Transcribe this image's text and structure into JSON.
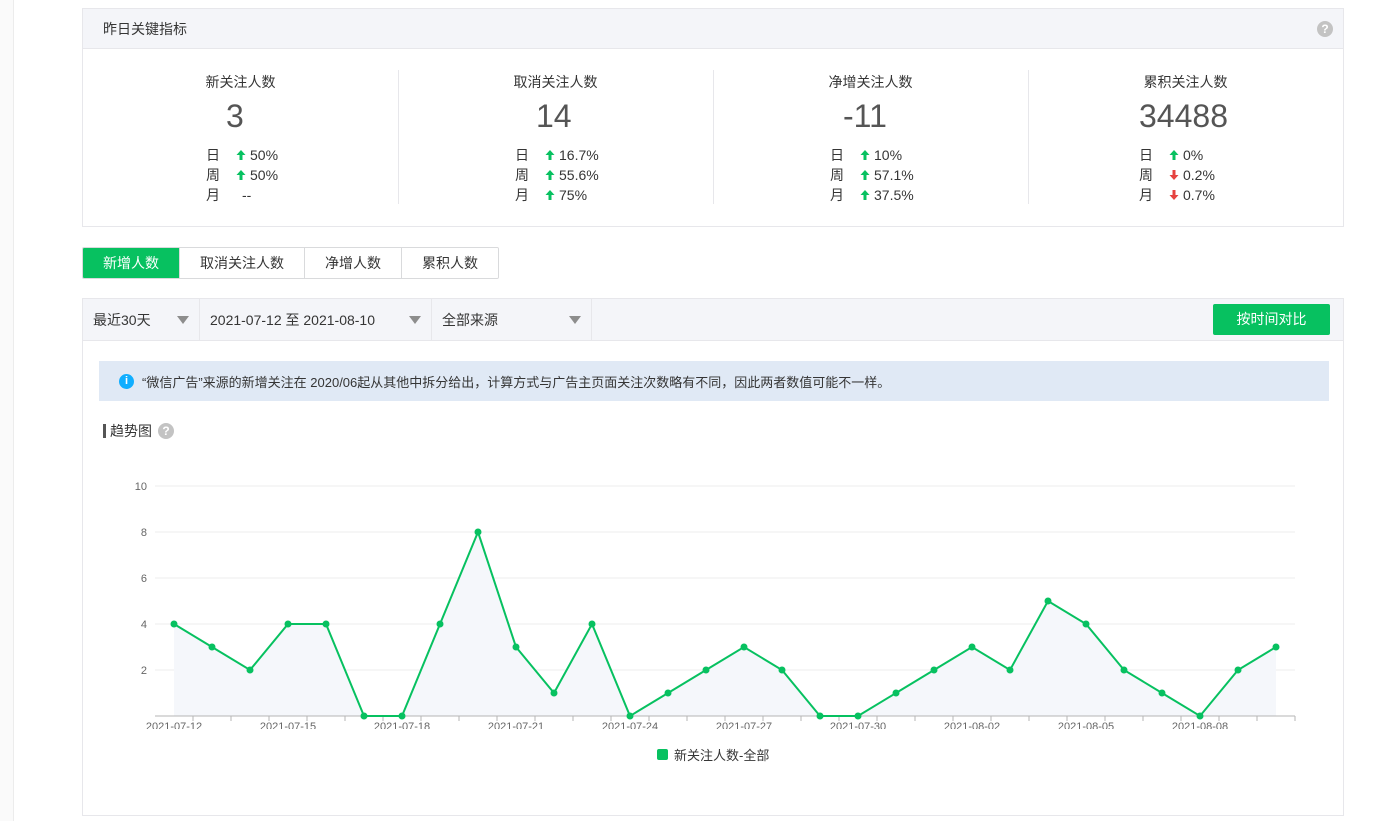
{
  "kpi": {
    "title": "昨日关键指标",
    "cards": [
      {
        "title": "新关注人数",
        "value": "3",
        "rows": [
          {
            "label": "日",
            "dir": "up",
            "value": "50%"
          },
          {
            "label": "周",
            "dir": "up",
            "value": "50%"
          },
          {
            "label": "月",
            "dir": "none",
            "value": "--"
          }
        ]
      },
      {
        "title": "取消关注人数",
        "value": "14",
        "rows": [
          {
            "label": "日",
            "dir": "up",
            "value": "16.7%"
          },
          {
            "label": "周",
            "dir": "up",
            "value": "55.6%"
          },
          {
            "label": "月",
            "dir": "up",
            "value": "75%"
          }
        ]
      },
      {
        "title": "净增关注人数",
        "value": "-11",
        "rows": [
          {
            "label": "日",
            "dir": "up",
            "value": "10%"
          },
          {
            "label": "周",
            "dir": "up",
            "value": "57.1%"
          },
          {
            "label": "月",
            "dir": "up",
            "value": "37.5%"
          }
        ]
      },
      {
        "title": "累积关注人数",
        "value": "34488",
        "rows": [
          {
            "label": "日",
            "dir": "up",
            "value": "0%"
          },
          {
            "label": "周",
            "dir": "down",
            "value": "0.2%"
          },
          {
            "label": "月",
            "dir": "down",
            "value": "0.7%"
          }
        ]
      }
    ]
  },
  "tabs": [
    {
      "label": "新增人数",
      "active": true
    },
    {
      "label": "取消关注人数",
      "active": false
    },
    {
      "label": "净增人数",
      "active": false
    },
    {
      "label": "累积人数",
      "active": false
    }
  ],
  "filters": {
    "range": "最近30天",
    "dates": "2021-07-12 至 2021-08-10",
    "source": "全部来源",
    "compare_button": "按时间对比"
  },
  "notice": "“微信广告”来源的新增关注在 2020/06起从其他中拆分给出，计算方式与广告主页面关注次数略有不同，因此两者数值可能不一样。",
  "trend_title": "趋势图",
  "colors": {
    "accent": "#07c160",
    "up": "#07c160",
    "down": "#e64340",
    "info": "#10aeff"
  },
  "icons": {
    "help": "question-circle-icon",
    "info": "info-circle-icon",
    "up": "arrow-up-icon",
    "down": "arrow-down-icon",
    "dropdown": "caret-down-icon"
  },
  "chart_data": {
    "type": "area",
    "x": [
      "2021-07-12",
      "2021-07-13",
      "2021-07-14",
      "2021-07-15",
      "2021-07-16",
      "2021-07-17",
      "2021-07-18",
      "2021-07-19",
      "2021-07-20",
      "2021-07-21",
      "2021-07-22",
      "2021-07-23",
      "2021-07-24",
      "2021-07-25",
      "2021-07-26",
      "2021-07-27",
      "2021-07-28",
      "2021-07-29",
      "2021-07-30",
      "2021-07-31",
      "2021-08-01",
      "2021-08-02",
      "2021-08-03",
      "2021-08-04",
      "2021-08-05",
      "2021-08-06",
      "2021-08-07",
      "2021-08-08",
      "2021-08-09",
      "2021-08-10"
    ],
    "x_tick_labels": [
      "2021-07-12",
      "2021-07-15",
      "2021-07-18",
      "2021-07-21",
      "2021-07-24",
      "2021-07-27",
      "2021-07-30",
      "2021-08-02",
      "2021-08-05",
      "2021-08-08"
    ],
    "series": [
      {
        "name": "新关注人数-全部",
        "color": "#07c160",
        "values": [
          4,
          3,
          2,
          4,
          4,
          0,
          0,
          4,
          8,
          3,
          1,
          4,
          0,
          1,
          2,
          3,
          2,
          0,
          0,
          1,
          2,
          3,
          2,
          5,
          4,
          2,
          1,
          0,
          2,
          3
        ]
      }
    ],
    "ylim": [
      0,
      10
    ],
    "y_ticks": [
      2,
      4,
      6,
      8,
      10
    ],
    "grid": true,
    "legend": "bottom-center"
  }
}
